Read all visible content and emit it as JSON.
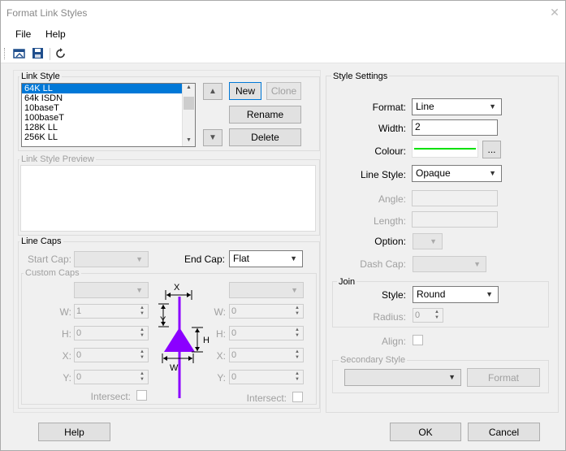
{
  "window": {
    "title": "Format Link Styles",
    "close_glyph": "✕"
  },
  "menu": {
    "file": "File",
    "help": "Help"
  },
  "toolbar": {
    "icons": [
      "open-icon",
      "save-icon",
      "refresh-icon"
    ]
  },
  "link_style": {
    "group_label": "Link Style",
    "items": [
      "64K LL",
      "64k ISDN",
      "10baseT",
      "100baseT",
      "128K LL",
      "256K LL"
    ],
    "selected_index": 0,
    "new_label": "New",
    "clone_label": "Clone",
    "rename_label": "Rename",
    "delete_label": "Delete",
    "up_glyph": "▲",
    "down_glyph": "▼"
  },
  "preview": {
    "group_label": "Link Style Preview"
  },
  "line_caps": {
    "group_label": "Line Caps",
    "start_cap_label": "Start Cap:",
    "start_cap_value": "",
    "end_cap_label": "End Cap:",
    "end_cap_value": "Flat",
    "custom_caps_label": "Custom Caps",
    "w_label": "W:",
    "h_label": "H:",
    "x_label": "X:",
    "y_label": "Y:",
    "left_w": "1",
    "left_h": "0",
    "left_x": "0",
    "left_y": "0",
    "right_w": "0",
    "right_h": "0",
    "right_x": "0",
    "right_y": "0",
    "intersect_label": "Intersect:",
    "diagram_x": "X",
    "diagram_y": "Y",
    "diagram_h": "H",
    "diagram_w": "W",
    "accent_color": "#8b00ff"
  },
  "style_settings": {
    "group_label": "Style Settings",
    "format_label": "Format:",
    "format_value": "Line",
    "width_label": "Width:",
    "width_value": "2",
    "colour_label": "Colour:",
    "colour_value": "#00e000",
    "colour_button": "...",
    "line_style_label": "Line Style:",
    "line_style_value": "Opaque",
    "angle_label": "Angle:",
    "length_label": "Length:",
    "option_label": "Option:",
    "dash_cap_label": "Dash Cap:",
    "join_label": "Join",
    "style_label": "Style:",
    "style_value": "Round",
    "radius_label": "Radius:",
    "radius_value": "0",
    "align_label": "Align:",
    "secondary_label": "Secondary Style",
    "format_button": "Format"
  },
  "footer": {
    "help": "Help",
    "ok": "OK",
    "cancel": "Cancel"
  }
}
